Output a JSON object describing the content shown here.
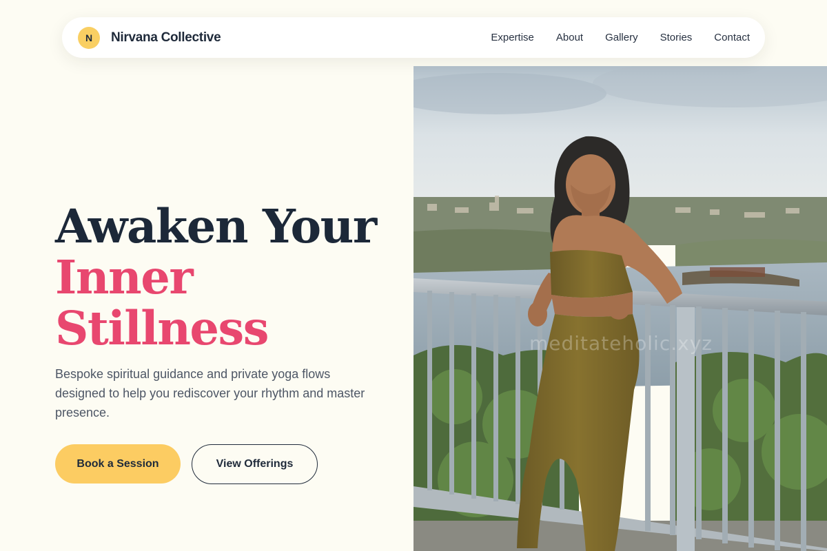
{
  "brand": {
    "initial": "N",
    "name": "Nirvana Collective"
  },
  "nav": {
    "links": [
      "Expertise",
      "About",
      "Gallery",
      "Stories",
      "Contact"
    ]
  },
  "hero": {
    "title_line1": "Awaken Your",
    "title_line2": "Inner",
    "title_line3": "Stillness",
    "description": "Bespoke spiritual guidance and private yoga flows designed to help you rediscover your rhythm and master presence.",
    "primary_cta": "Book a Session",
    "secondary_cta": "View Offerings",
    "image_alt": "Smiling woman in olive activewear leaning on a railing overlooking a city and water",
    "watermark": "meditateholic.xyz"
  },
  "colors": {
    "background": "#fdfcf3",
    "accent_yellow": "#fccc62",
    "accent_pink": "#e8476f",
    "text_dark": "#1c2838",
    "text_muted": "#4d5665"
  }
}
